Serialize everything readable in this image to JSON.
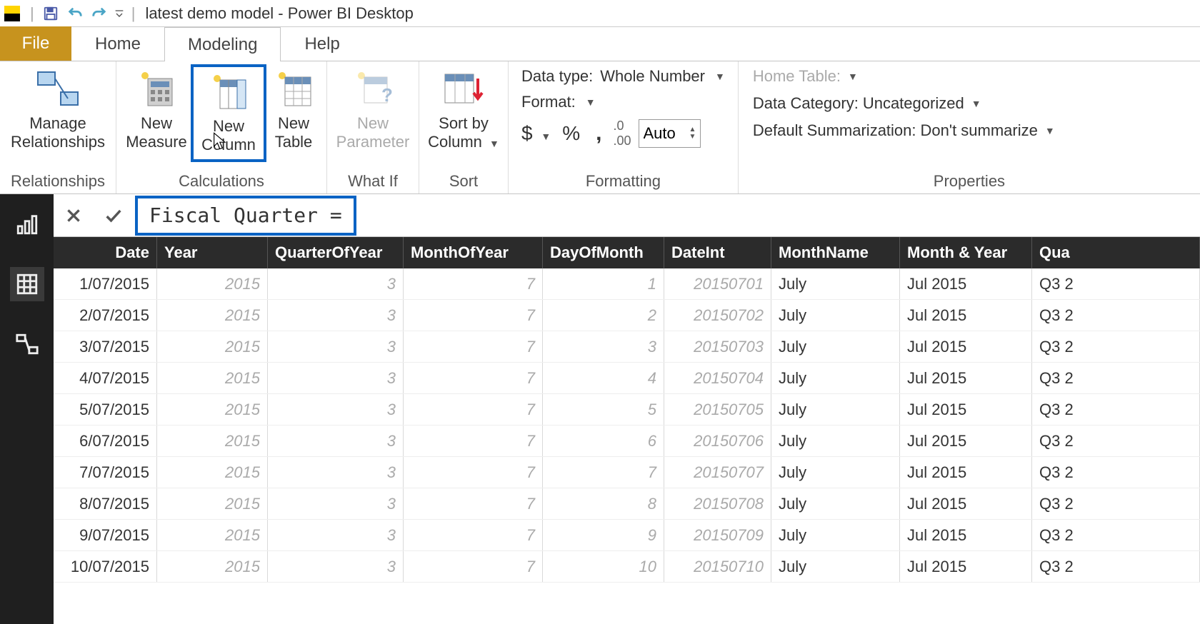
{
  "titlebar": {
    "title": "latest demo model - Power BI Desktop"
  },
  "tabs": {
    "file": "File",
    "home": "Home",
    "modeling": "Modeling",
    "help": "Help"
  },
  "ribbon": {
    "relationships": {
      "manage": "Manage Relationships",
      "group": "Relationships"
    },
    "calculations": {
      "measure": "New Measure",
      "column": "New Column",
      "table": "New Table",
      "group": "Calculations"
    },
    "whatif": {
      "param": "New Parameter",
      "group": "What If"
    },
    "sort": {
      "sortby": "Sort by Column",
      "group": "Sort"
    },
    "formatting": {
      "datatype_label": "Data type:",
      "datatype_value": "Whole Number",
      "format_label": "Format:",
      "currency": "$",
      "percent": "%",
      "comma": ",",
      "decimals_icon": ".00",
      "decimals_value": "Auto",
      "group": "Formatting"
    },
    "properties": {
      "hometable_label": "Home Table:",
      "datacat_label": "Data Category:",
      "datacat_value": "Uncategorized",
      "summ_label": "Default Summarization:",
      "summ_value": "Don't summarize",
      "group": "Properties"
    }
  },
  "formula": {
    "text": "Fiscal Quarter ="
  },
  "grid": {
    "headers": [
      "Date",
      "Year",
      "QuarterOfYear",
      "MonthOfYear",
      "DayOfMonth",
      "DateInt",
      "MonthName",
      "Month & Year",
      "Qua"
    ],
    "rows": [
      {
        "date": "1/07/2015",
        "year": "2015",
        "quarter": "3",
        "month": "7",
        "day": "1",
        "dateint": "20150701",
        "monthname": "July",
        "monthyear": "Jul 2015",
        "qua": "Q3 2"
      },
      {
        "date": "2/07/2015",
        "year": "2015",
        "quarter": "3",
        "month": "7",
        "day": "2",
        "dateint": "20150702",
        "monthname": "July",
        "monthyear": "Jul 2015",
        "qua": "Q3 2"
      },
      {
        "date": "3/07/2015",
        "year": "2015",
        "quarter": "3",
        "month": "7",
        "day": "3",
        "dateint": "20150703",
        "monthname": "July",
        "monthyear": "Jul 2015",
        "qua": "Q3 2"
      },
      {
        "date": "4/07/2015",
        "year": "2015",
        "quarter": "3",
        "month": "7",
        "day": "4",
        "dateint": "20150704",
        "monthname": "July",
        "monthyear": "Jul 2015",
        "qua": "Q3 2"
      },
      {
        "date": "5/07/2015",
        "year": "2015",
        "quarter": "3",
        "month": "7",
        "day": "5",
        "dateint": "20150705",
        "monthname": "July",
        "monthyear": "Jul 2015",
        "qua": "Q3 2"
      },
      {
        "date": "6/07/2015",
        "year": "2015",
        "quarter": "3",
        "month": "7",
        "day": "6",
        "dateint": "20150706",
        "monthname": "July",
        "monthyear": "Jul 2015",
        "qua": "Q3 2"
      },
      {
        "date": "7/07/2015",
        "year": "2015",
        "quarter": "3",
        "month": "7",
        "day": "7",
        "dateint": "20150707",
        "monthname": "July",
        "monthyear": "Jul 2015",
        "qua": "Q3 2"
      },
      {
        "date": "8/07/2015",
        "year": "2015",
        "quarter": "3",
        "month": "7",
        "day": "8",
        "dateint": "20150708",
        "monthname": "July",
        "monthyear": "Jul 2015",
        "qua": "Q3 2"
      },
      {
        "date": "9/07/2015",
        "year": "2015",
        "quarter": "3",
        "month": "7",
        "day": "9",
        "dateint": "20150709",
        "monthname": "July",
        "monthyear": "Jul 2015",
        "qua": "Q3 2"
      },
      {
        "date": "10/07/2015",
        "year": "2015",
        "quarter": "3",
        "month": "7",
        "day": "10",
        "dateint": "20150710",
        "monthname": "July",
        "monthyear": "Jul 2015",
        "qua": "Q3 2"
      }
    ]
  }
}
